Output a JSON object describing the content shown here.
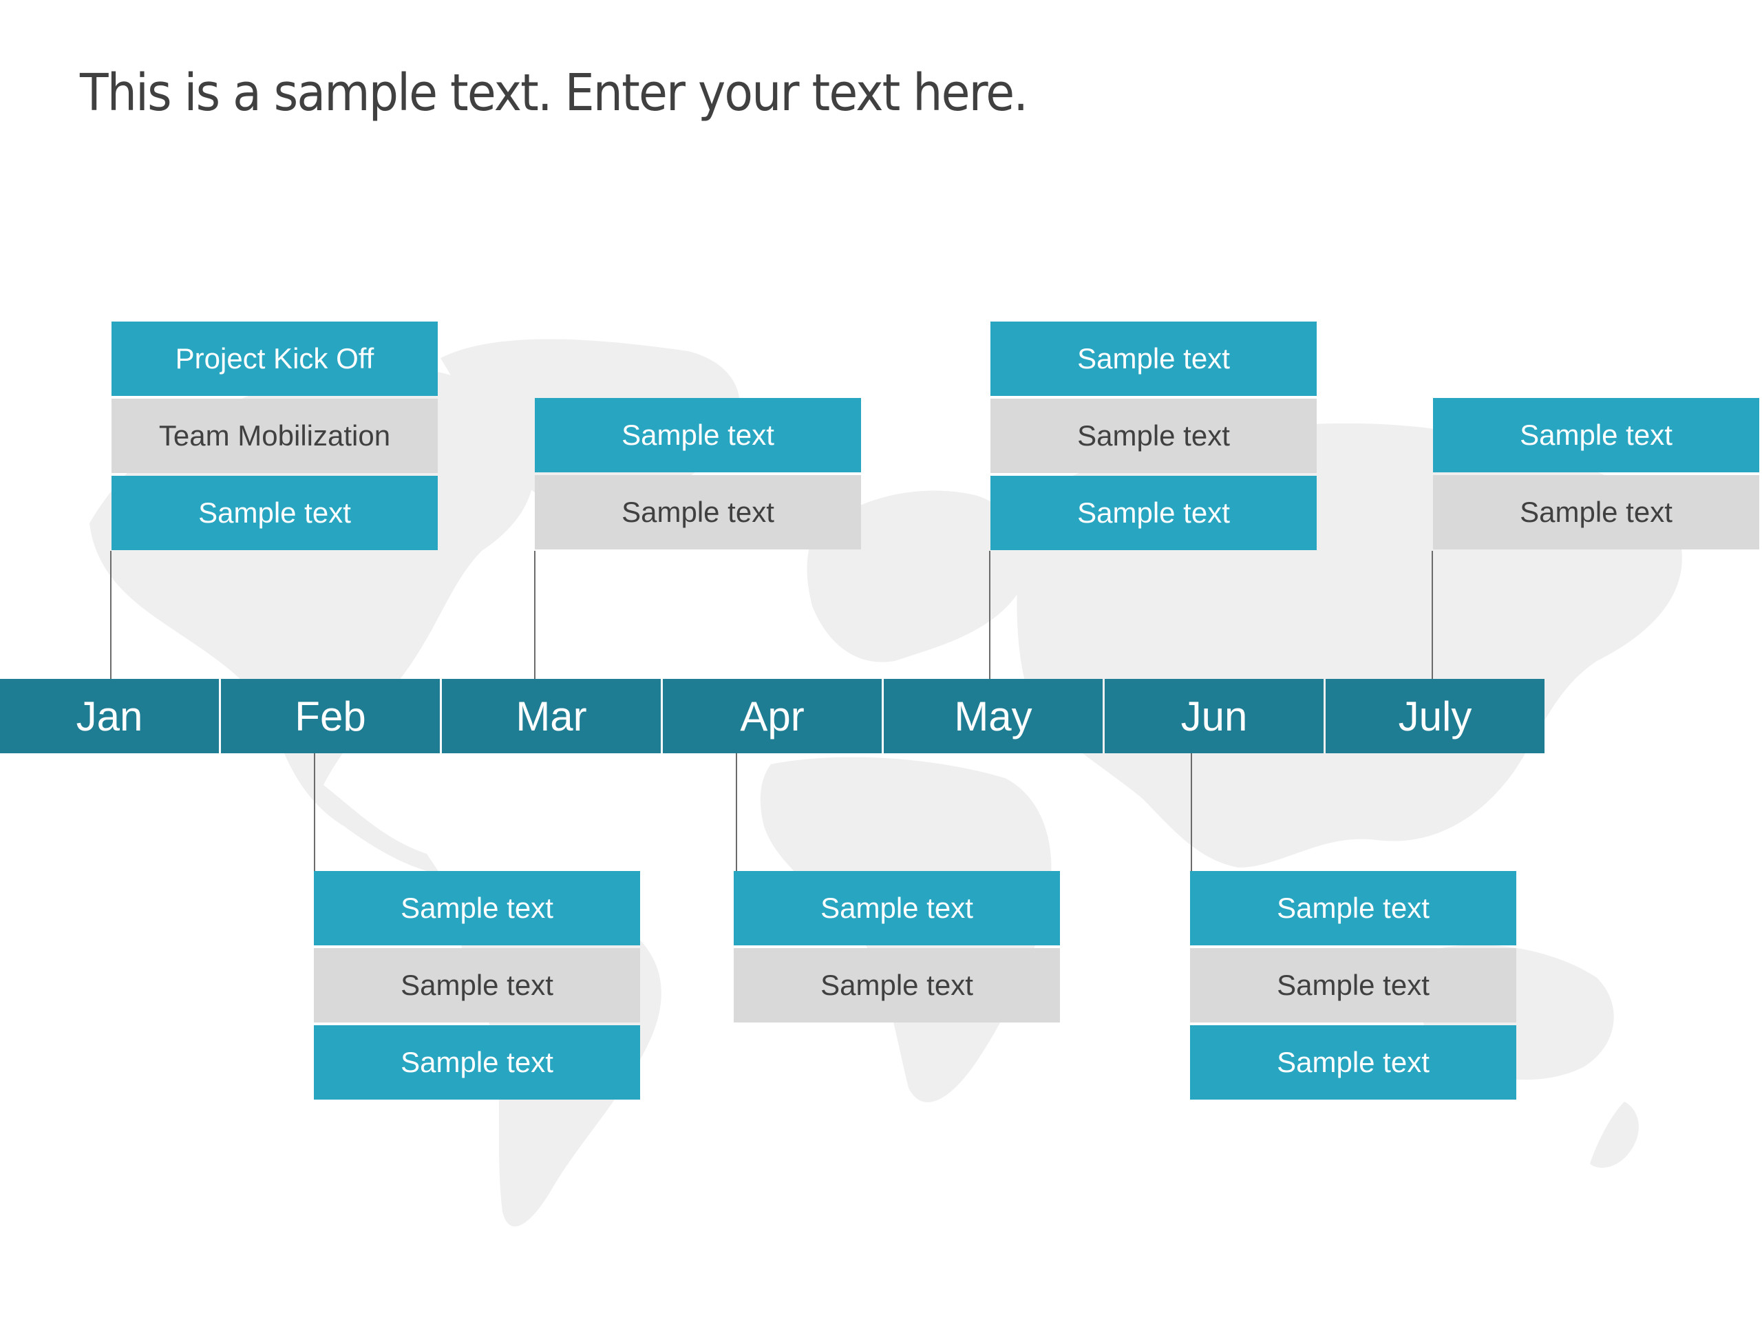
{
  "title": "This is a sample text. Enter your text here.",
  "colors": {
    "accent_light": "#28A5C1",
    "accent_dark": "#1F7D93",
    "neutral": "#D9D9D9",
    "text_dark": "#404040",
    "map": "#EFEFEF"
  },
  "timeline": {
    "months": [
      "Jan",
      "Feb",
      "Mar",
      "Apr",
      "May",
      "Jun",
      "July"
    ]
  },
  "milestones": {
    "jan": [
      {
        "text": "Project Kick Off",
        "style": "teal"
      },
      {
        "text": "Team Mobilization",
        "style": "gray"
      },
      {
        "text": "Sample text",
        "style": "teal"
      }
    ],
    "feb": [
      {
        "text": "Sample text",
        "style": "teal"
      },
      {
        "text": "Sample text",
        "style": "gray"
      },
      {
        "text": "Sample text",
        "style": "teal"
      }
    ],
    "mar": [
      {
        "text": "Sample text",
        "style": "teal"
      },
      {
        "text": "Sample text",
        "style": "gray"
      }
    ],
    "apr": [
      {
        "text": "Sample text",
        "style": "teal"
      },
      {
        "text": "Sample text",
        "style": "gray"
      }
    ],
    "may": [
      {
        "text": "Sample text",
        "style": "teal"
      },
      {
        "text": "Sample text",
        "style": "gray"
      },
      {
        "text": "Sample text",
        "style": "teal"
      }
    ],
    "jun": [
      {
        "text": "Sample text",
        "style": "teal"
      },
      {
        "text": "Sample text",
        "style": "gray"
      },
      {
        "text": "Sample text",
        "style": "teal"
      }
    ],
    "july": [
      {
        "text": "Sample text",
        "style": "teal"
      },
      {
        "text": "Sample text",
        "style": "gray"
      }
    ]
  }
}
